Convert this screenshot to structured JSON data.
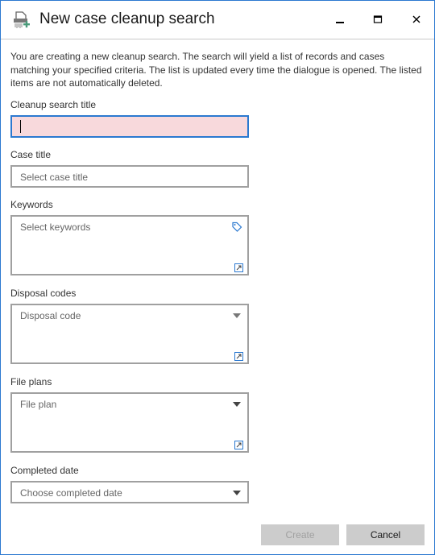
{
  "window": {
    "title": "New case cleanup search",
    "app_icon": "shredder-add-icon",
    "controls": {
      "minimize": "minimize-icon",
      "maximize": "maximize-icon",
      "close": "close-icon"
    }
  },
  "intro_text": "You are creating a new cleanup search. The search will yield a list of records and cases matching your specified criteria. The list is updated every time the dialogue is opened. The listed items are not automatically deleted.",
  "form": {
    "cleanup_search_title": {
      "label": "Cleanup search title",
      "value": "",
      "state": "required-empty-focused"
    },
    "case_title": {
      "label": "Case title",
      "placeholder": "Select case title"
    },
    "keywords": {
      "label": "Keywords",
      "placeholder": "Select keywords",
      "icon": "tag-icon",
      "expand_icon": "expand-icon"
    },
    "disposal_codes": {
      "label": "Disposal codes",
      "placeholder": "Disposal code",
      "icon": "dropdown-arrow-icon",
      "expand_icon": "expand-icon"
    },
    "file_plans": {
      "label": "File plans",
      "placeholder": "File plan",
      "icon": "dropdown-arrow-icon",
      "expand_icon": "expand-icon"
    },
    "completed_date": {
      "label": "Completed date",
      "placeholder": "Choose completed date",
      "icon": "dropdown-arrow-icon"
    }
  },
  "buttons": {
    "create": {
      "label": "Create",
      "enabled": false
    },
    "cancel": {
      "label": "Cancel",
      "enabled": true
    }
  },
  "colors": {
    "accent": "#2b79d0",
    "invalid_field_bg": "#f8d9dc",
    "button_bg": "#cccccc",
    "icon_green": "#4a9a7a"
  }
}
